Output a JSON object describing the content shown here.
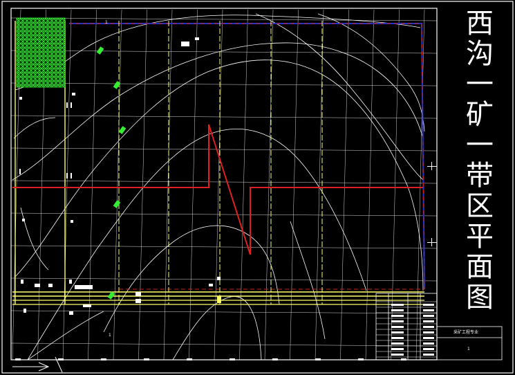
{
  "drawing": {
    "title_chars": [
      "西",
      "沟",
      "一",
      "矿",
      "一",
      "带",
      "区",
      "平",
      "面",
      "图"
    ],
    "title_block": {
      "designer_label": "采矿工程专业",
      "sheet_no": "1"
    },
    "tag_upper": "1",
    "tag_lower": "1"
  },
  "colors": {
    "background": "#000000",
    "frame": "#ffffff",
    "grid": "#ffffff",
    "contour": "#ffffff",
    "road": "#ffff66",
    "fault": "#e02020",
    "boundary": "#2233cc",
    "boundary_dash": "#cc2222",
    "forest": "#33ee33",
    "label_green": "#33ee33",
    "title_text": "#ffffff"
  },
  "icons": {
    "forest": "tree-hatch-icon",
    "north_arrow": "arrow-icon"
  }
}
